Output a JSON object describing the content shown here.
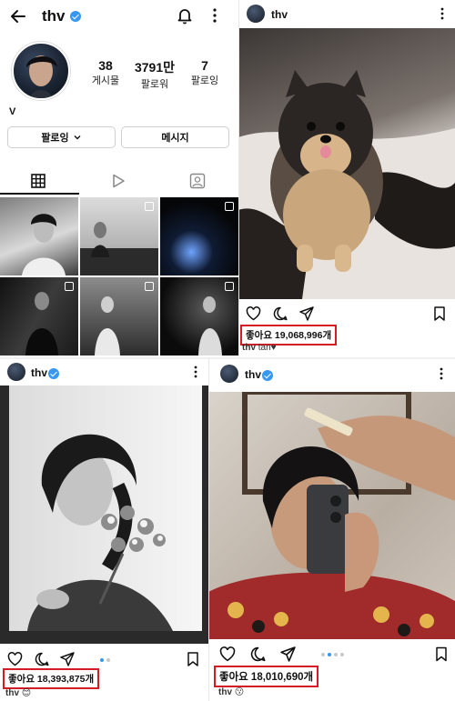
{
  "profile": {
    "username": "thv",
    "stats": [
      {
        "num": "38",
        "label": "게시물"
      },
      {
        "num": "3791만",
        "label": "팔로워"
      },
      {
        "num": "7",
        "label": "팔로잉"
      }
    ],
    "bio_name": "V",
    "follow_button": "팔로잉",
    "message_button": "메시지"
  },
  "posts": [
    {
      "username": "thv",
      "likes_text": "좋아요 19,068,996개",
      "caption_user": "thv",
      "caption_text": "tan♥"
    },
    {
      "username": "thv",
      "likes_text": "좋아요 18,393,875개",
      "caption_user": "thv",
      "caption_text": "😊"
    },
    {
      "username": "thv",
      "likes_text": "좋아요 18,010,690개",
      "caption_user": "thv",
      "caption_text": "😗"
    }
  ],
  "icons": {
    "back": "back-arrow-icon",
    "notifications": "bell-icon",
    "more": "more-vertical-icon",
    "grid": "grid-icon",
    "reels": "reels-icon",
    "tagged": "tagged-icon",
    "like": "heart-icon",
    "comment": "comment-icon",
    "share": "send-icon",
    "save": "bookmark-icon"
  },
  "colors": {
    "verified": "#3897f0",
    "highlight_box": "#d51b24",
    "dot_active": "#3897f0"
  }
}
